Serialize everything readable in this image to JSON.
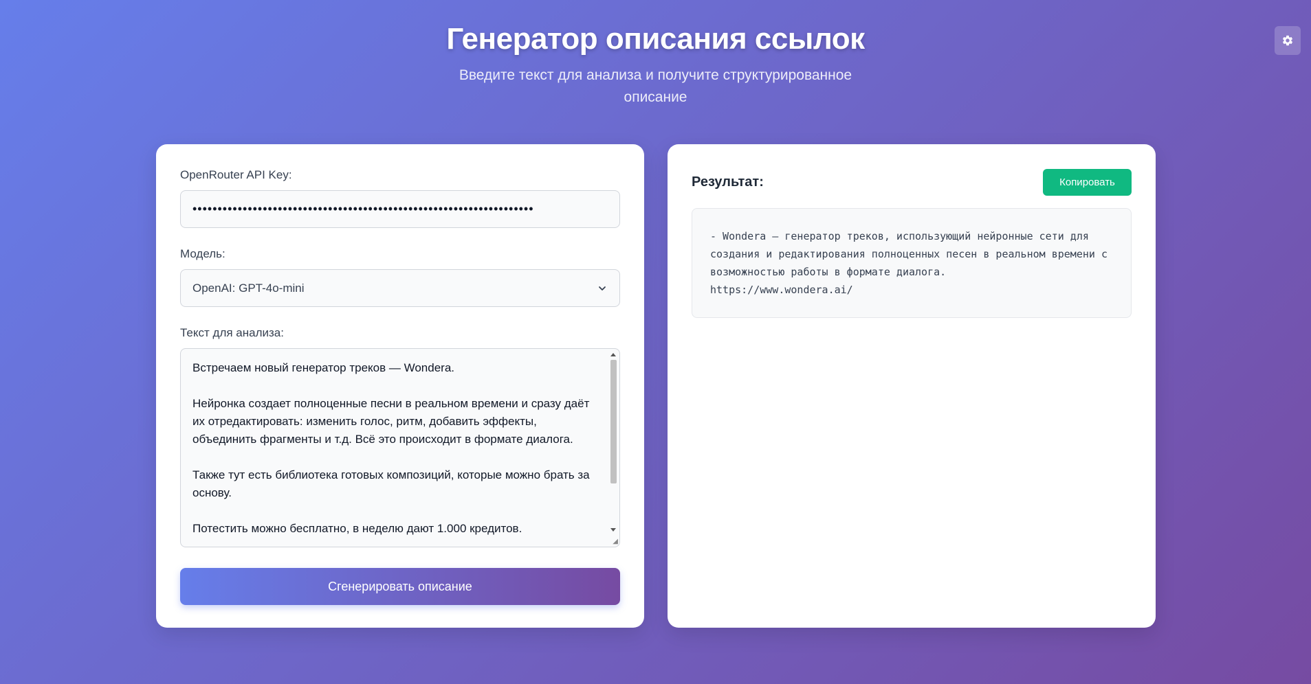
{
  "header": {
    "title": "Генератор описания ссылок",
    "subtitle": "Введите текст для анализа и получите структурированное описание"
  },
  "settings": {
    "icon": "gear-icon"
  },
  "form": {
    "api_key_label": "OpenRouter API Key:",
    "api_key_value": "••••••••••••••••••••••••••••••••••••••••••••••••••••••••••••••••••••",
    "model_label": "Модель:",
    "model_value": "OpenAI: GPT-4o-mini",
    "text_label": "Текст для анализа:",
    "text_value": "Встречаем новый генератор треков — Wondera.\n\nНейронка создает полноценные песни в реальном времени и сразу даёт их отредактировать: изменить голос, ритм, добавить эффекты, объединить фрагменты и т.д. Всё это происходит в формате диалога.\n\nТакже тут есть библиотека готовых композиций, которые можно брать за основу.\n\nПотестить можно бесплатно, в неделю дают 1.000 кредитов.",
    "generate_label": "Сгенерировать описание"
  },
  "result": {
    "title": "Результат:",
    "copy_label": "Копировать",
    "content": "- Wondera — генератор треков, использующий нейронные сети для создания и редактирования полноценных песен в реальном времени с возможностью работы в формате диалога.\nhttps://www.wondera.ai/"
  },
  "colors": {
    "gradient_start": "#667eea",
    "gradient_end": "#764ba2",
    "copy_button": "#10b981"
  }
}
